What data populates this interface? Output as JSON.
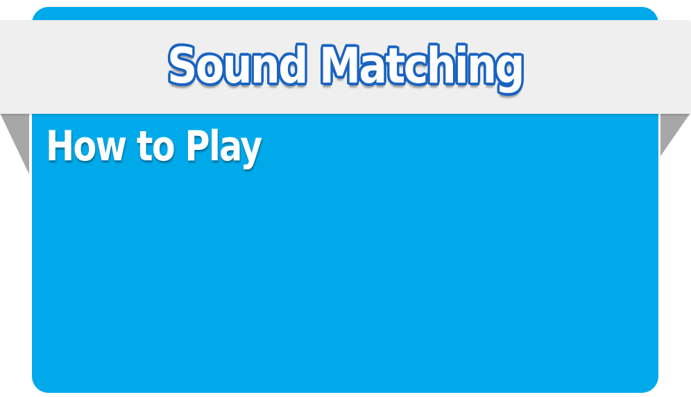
{
  "game": {
    "title": "Sound Matching",
    "section_heading": "How to Play"
  },
  "colors": {
    "panel": "#00aaea",
    "ribbon": "#efefef",
    "ribbon_fold": "#a7a7a7",
    "title_outline": "#1a63c0",
    "text": "#ffffff"
  }
}
